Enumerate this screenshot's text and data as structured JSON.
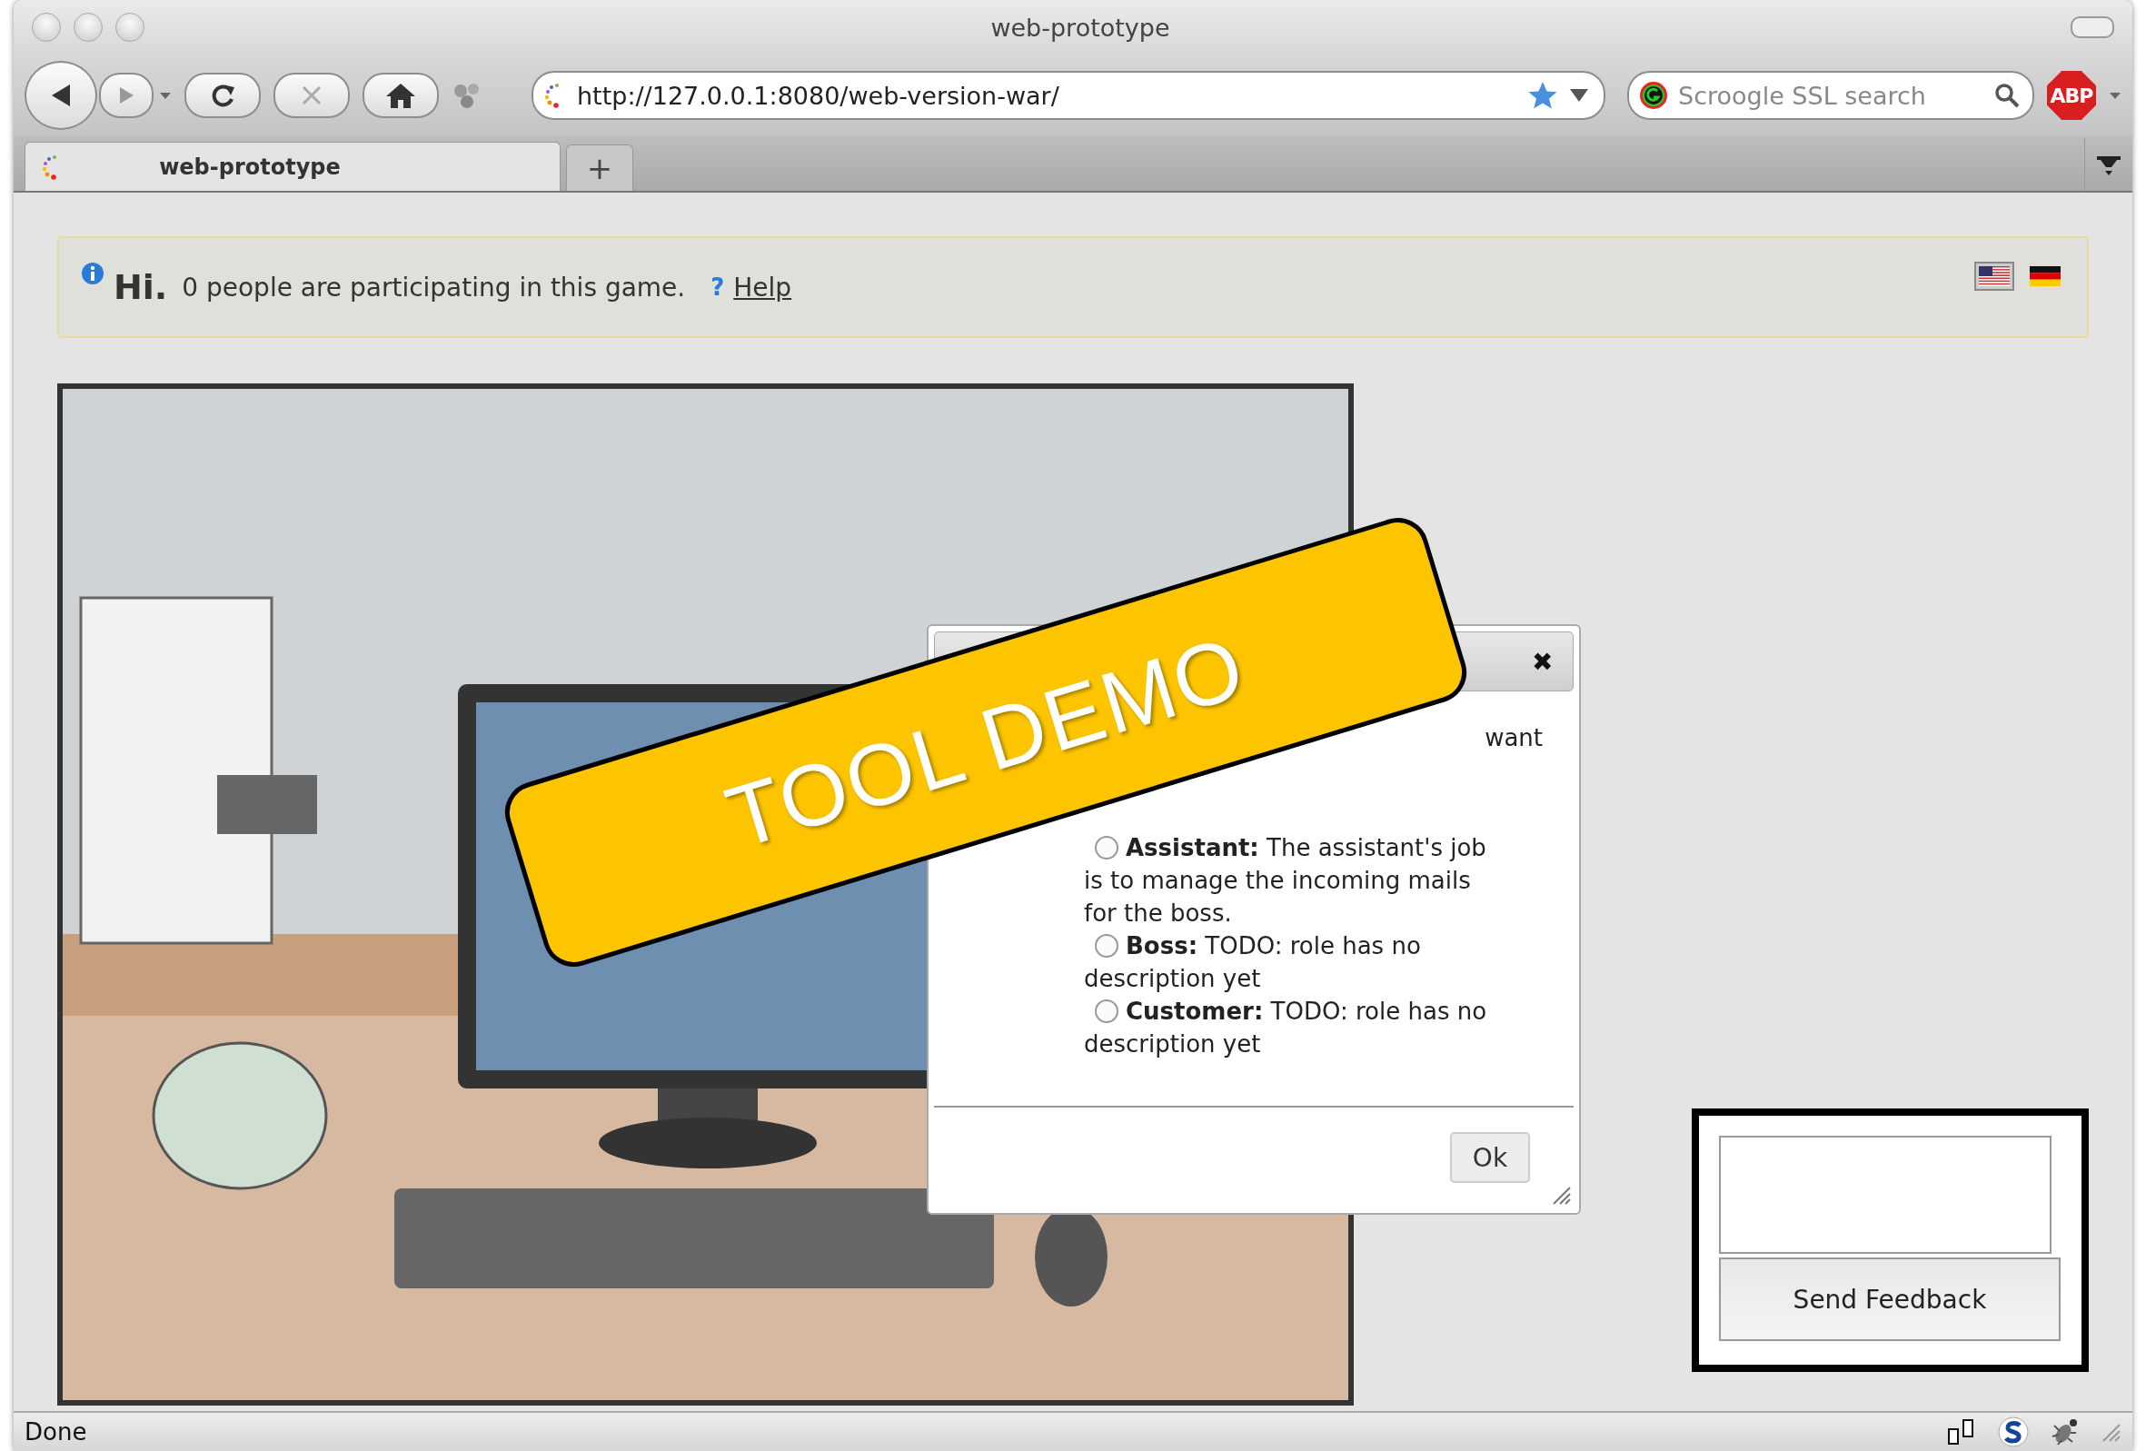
{
  "window": {
    "title": "web-prototype"
  },
  "toolbar": {
    "url": "http://127.0.0.1:8080/web-version-war/",
    "search": {
      "placeholder": "Scroogle SSL search"
    },
    "adblock_label": "ABP"
  },
  "tabs": [
    {
      "label": "web-prototype",
      "selected": true
    }
  ],
  "new_tab_label": "+",
  "info_bar": {
    "greeting": "Hi.",
    "message": "0 people are participating in this game.",
    "help_mark": "?",
    "help_link": "Help"
  },
  "languages": [
    {
      "kind": "us",
      "selected": true
    },
    {
      "kind": "de",
      "selected": false
    }
  ],
  "dialog": {
    "close": "✖",
    "intro_fragment": "want",
    "roles": [
      {
        "name": "Assistant:",
        "description": "The assistant's job is to manage the incoming mails for the boss.",
        "selected": false
      },
      {
        "name": "Boss:",
        "description": "TODO: role has no description yet",
        "selected": false
      },
      {
        "name": "Customer:",
        "description": "TODO: role has no description yet",
        "selected": false
      }
    ],
    "ok": "Ok"
  },
  "feedback": {
    "button": "Send Feedback"
  },
  "banner": {
    "text": "TOOL DEMO"
  },
  "status_bar": {
    "text": "Done"
  }
}
